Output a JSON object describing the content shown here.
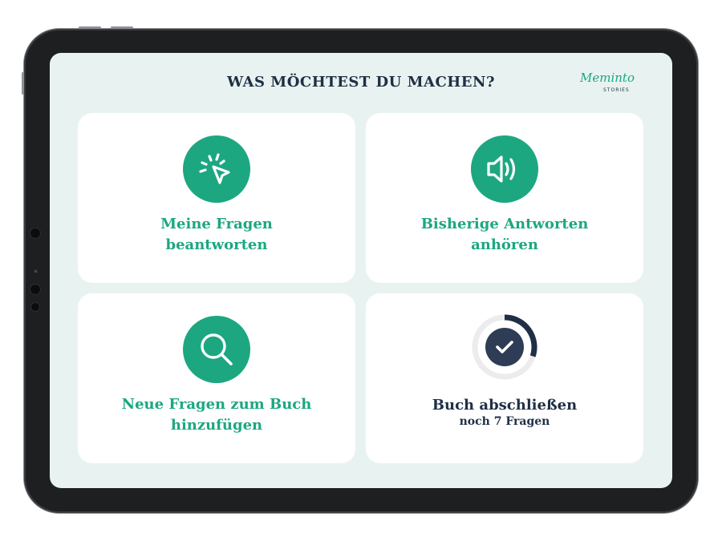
{
  "header": {
    "title": "WAS MÖCHTEST DU MACHEN?",
    "logo_script": "Meminto",
    "logo_sub": "STORIES"
  },
  "cards": [
    {
      "label": "Meine Fragen\nbeantworten",
      "icon": "tap-pointer-icon"
    },
    {
      "label": "Bisherige Antworten\nanhören",
      "icon": "speaker-icon"
    },
    {
      "label": "Neue Fragen zum Buch\nhinzufügen",
      "icon": "search-icon"
    },
    {
      "label": "Buch abschließen",
      "sublabel": "noch 7 Fragen",
      "icon": "checkmark-icon",
      "progress": 0.3
    }
  ],
  "colors": {
    "accent": "#1ca781",
    "navy": "#1f2f45",
    "screen_bg": "#e8f3f1",
    "card_bg": "#ffffff"
  }
}
